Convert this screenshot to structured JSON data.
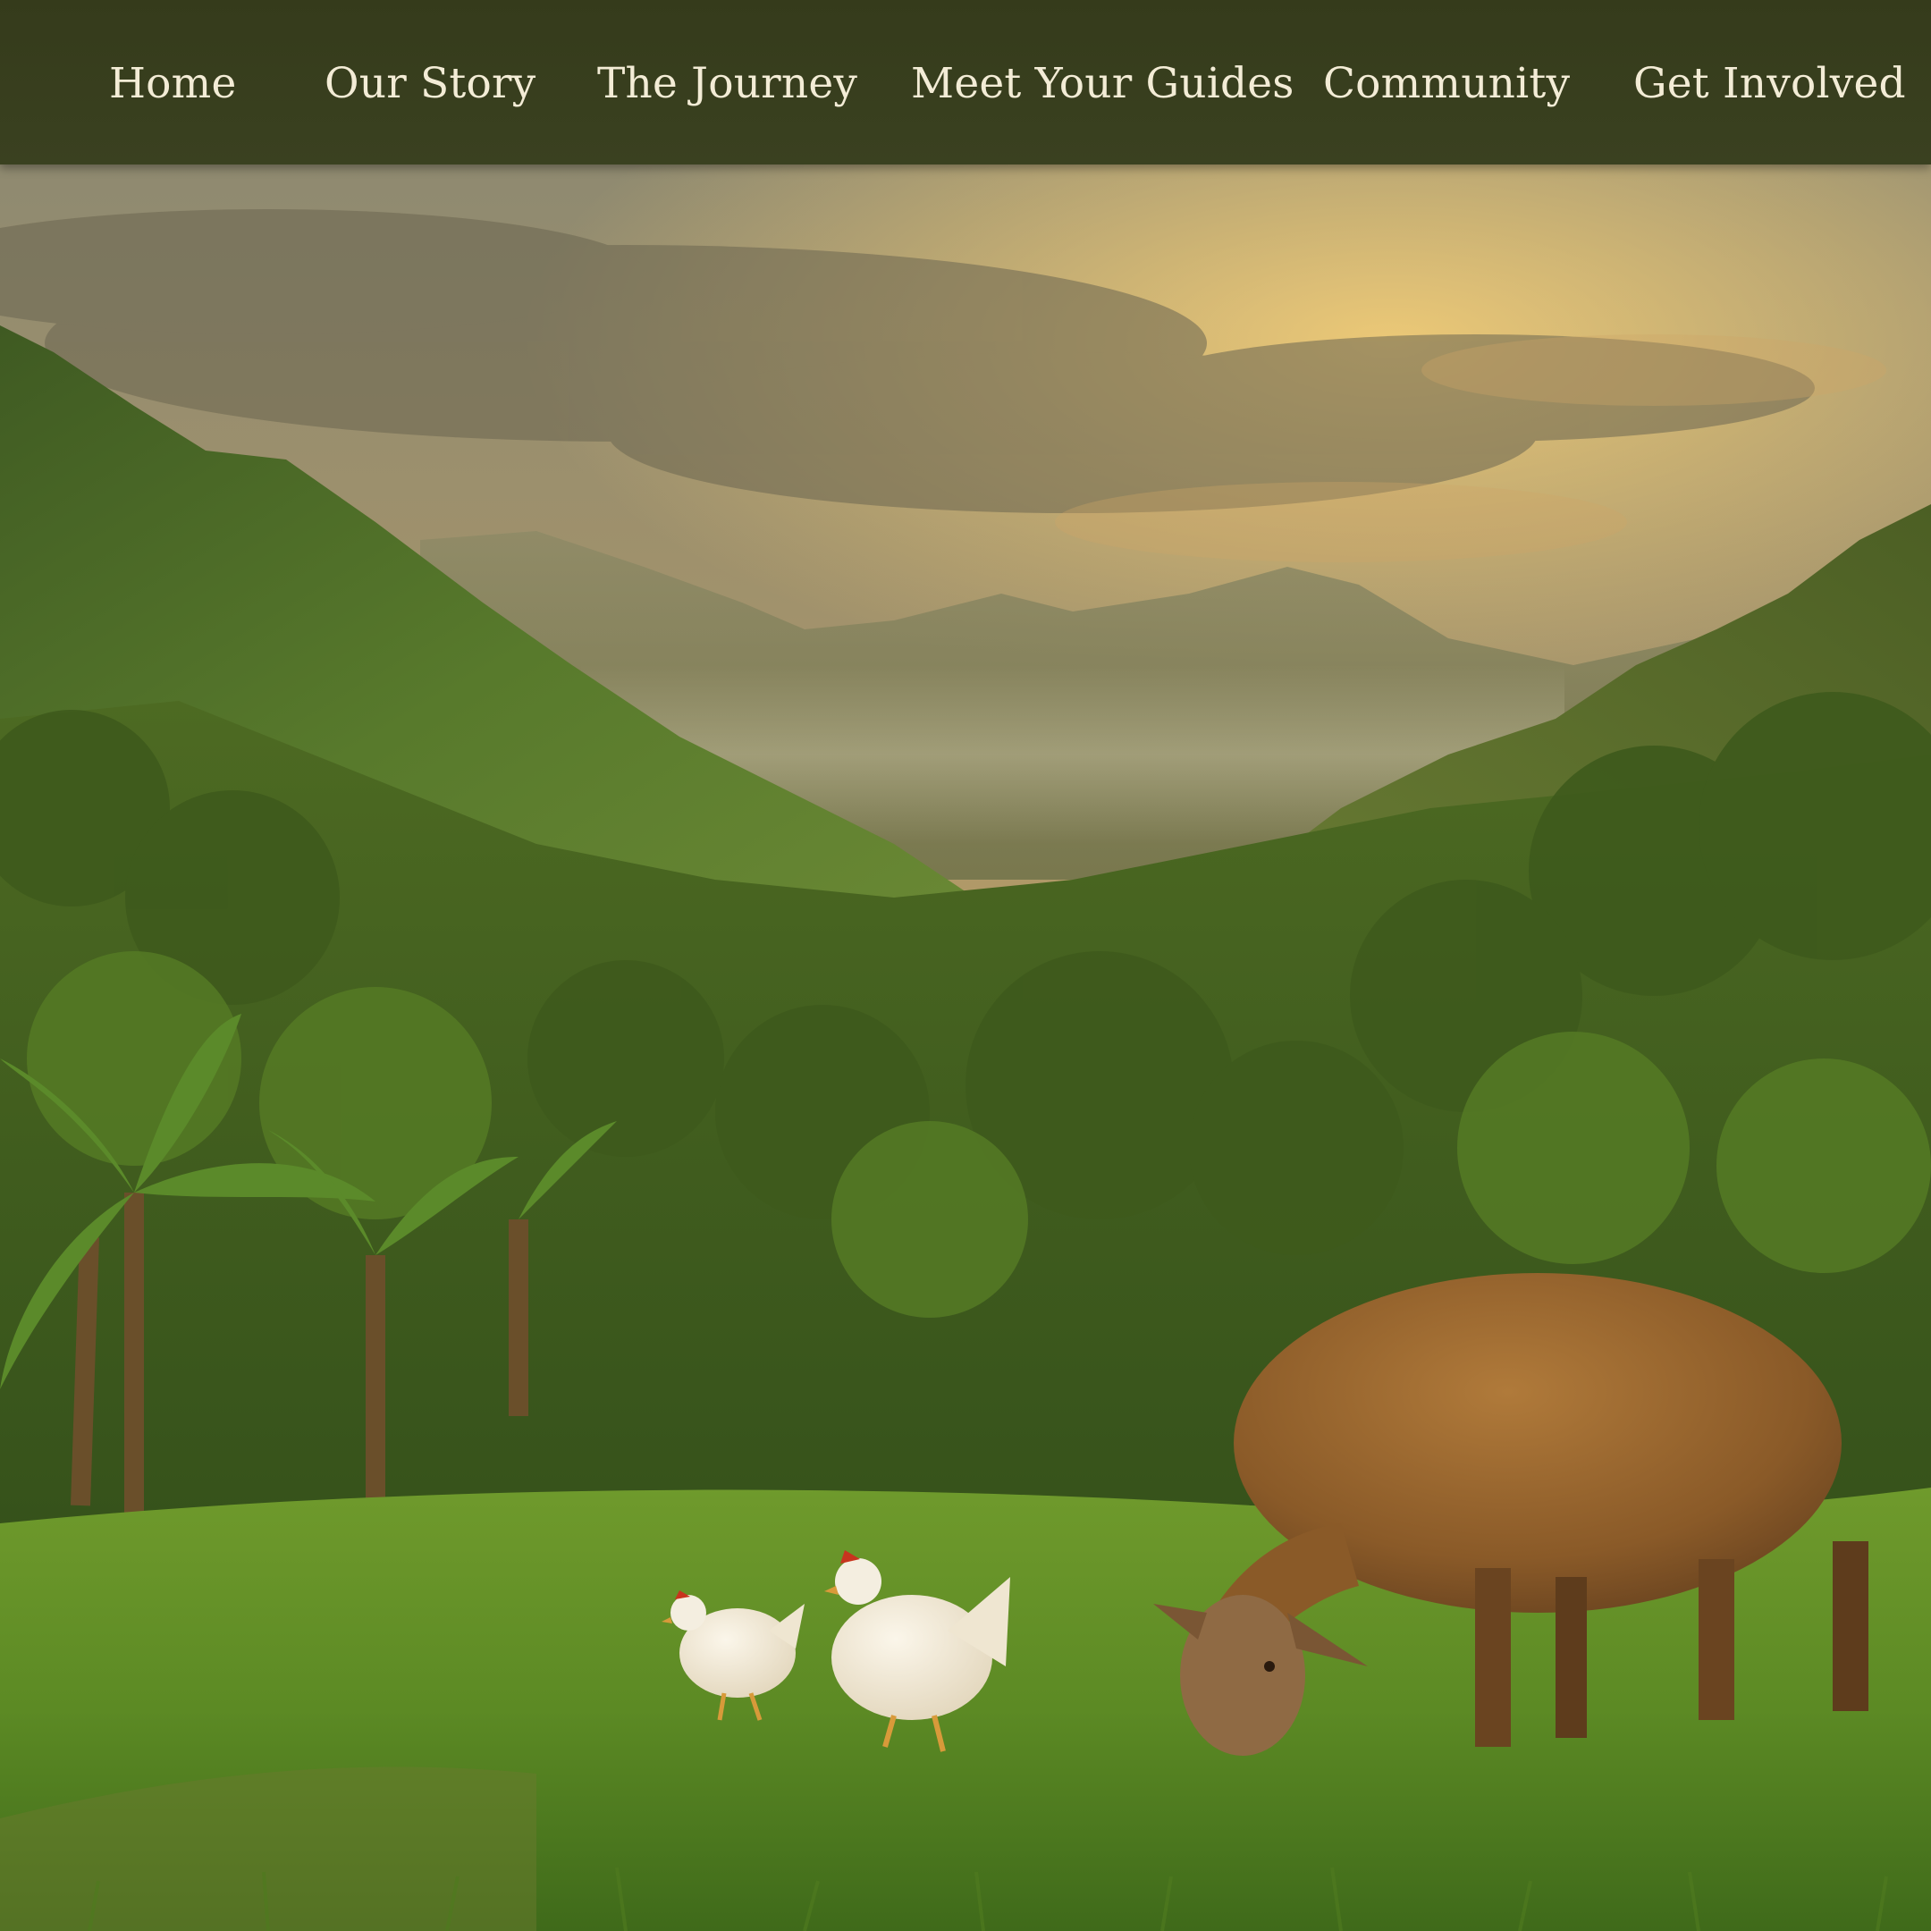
{
  "nav": {
    "items": [
      {
        "label": "Home"
      },
      {
        "label": "Our Story"
      },
      {
        "label": "The Journey"
      },
      {
        "label": "Meet Your Guides"
      },
      {
        "label": "Community"
      },
      {
        "label": "Get Involved"
      }
    ]
  },
  "colors": {
    "nav_background": "#3a4120",
    "nav_text": "#f3ecd6"
  }
}
